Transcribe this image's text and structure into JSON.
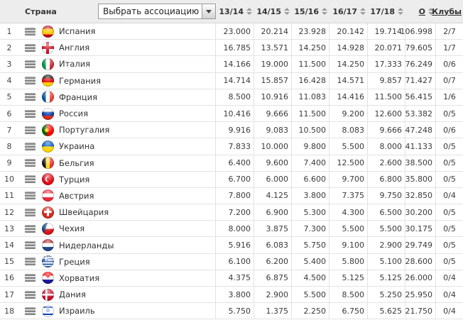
{
  "colors": {
    "header_bg": "#ededed",
    "row_border": "#e3e3e3",
    "text": "#333333",
    "sort_arrow": "#9b9b9b"
  },
  "header": {
    "country_label": "Страна",
    "dropdown_value": "Выбрать ассоциацию",
    "season_columns": [
      "13/14",
      "14/15",
      "15/16",
      "16/17",
      "17/18"
    ],
    "total_label": "О",
    "clubs_label": "Клубы"
  },
  "rows": [
    {
      "rank": "1",
      "flag": "es",
      "country": "Испания",
      "seasons": [
        "23.000",
        "20.214",
        "23.928",
        "20.142",
        "19.714"
      ],
      "total": "106.998",
      "clubs": "2/7"
    },
    {
      "rank": "2",
      "flag": "en",
      "country": "Англия",
      "seasons": [
        "16.785",
        "13.571",
        "14.250",
        "14.928",
        "20.071"
      ],
      "total": "79.605",
      "clubs": "1/7"
    },
    {
      "rank": "3",
      "flag": "it",
      "country": "Италия",
      "seasons": [
        "14.166",
        "19.000",
        "11.500",
        "14.250",
        "17.333"
      ],
      "total": "76.249",
      "clubs": "0/6"
    },
    {
      "rank": "4",
      "flag": "de",
      "country": "Германия",
      "seasons": [
        "14.714",
        "15.857",
        "16.428",
        "14.571",
        "9.857"
      ],
      "total": "71.427",
      "clubs": "0/7"
    },
    {
      "rank": "5",
      "flag": "fr",
      "country": "Франция",
      "seasons": [
        "8.500",
        "10.916",
        "11.083",
        "14.416",
        "11.500"
      ],
      "total": "56.415",
      "clubs": "1/6"
    },
    {
      "rank": "6",
      "flag": "ru",
      "country": "Россия",
      "seasons": [
        "10.416",
        "9.666",
        "11.500",
        "9.200",
        "12.600"
      ],
      "total": "53.382",
      "clubs": "0/5"
    },
    {
      "rank": "7",
      "flag": "pt",
      "country": "Португалия",
      "seasons": [
        "9.916",
        "9.083",
        "10.500",
        "8.083",
        "9.666"
      ],
      "total": "47.248",
      "clubs": "0/6"
    },
    {
      "rank": "8",
      "flag": "ua",
      "country": "Украина",
      "seasons": [
        "7.833",
        "10.000",
        "9.800",
        "5.500",
        "8.000"
      ],
      "total": "41.133",
      "clubs": "0/5"
    },
    {
      "rank": "9",
      "flag": "be",
      "country": "Бельгия",
      "seasons": [
        "6.400",
        "9.600",
        "7.400",
        "12.500",
        "2.600"
      ],
      "total": "38.500",
      "clubs": "0/5"
    },
    {
      "rank": "10",
      "flag": "tr",
      "country": "Турция",
      "seasons": [
        "6.700",
        "6.000",
        "6.600",
        "9.700",
        "6.800"
      ],
      "total": "35.800",
      "clubs": "0/5"
    },
    {
      "rank": "11",
      "flag": "at",
      "country": "Австрия",
      "seasons": [
        "7.800",
        "4.125",
        "3.800",
        "7.375",
        "9.750"
      ],
      "total": "32.850",
      "clubs": "0/4"
    },
    {
      "rank": "12",
      "flag": "ch",
      "country": "Швейцария",
      "seasons": [
        "7.200",
        "6.900",
        "5.300",
        "4.300",
        "6.500"
      ],
      "total": "30.200",
      "clubs": "0/5"
    },
    {
      "rank": "13",
      "flag": "cz",
      "country": "Чехия",
      "seasons": [
        "8.000",
        "3.875",
        "7.300",
        "5.500",
        "5.500"
      ],
      "total": "30.175",
      "clubs": "0/5"
    },
    {
      "rank": "14",
      "flag": "nl",
      "country": "Нидерланды",
      "seasons": [
        "5.916",
        "6.083",
        "5.750",
        "9.100",
        "2.900"
      ],
      "total": "29.749",
      "clubs": "0/5"
    },
    {
      "rank": "15",
      "flag": "gr",
      "country": "Греция",
      "seasons": [
        "6.100",
        "6.200",
        "5.400",
        "5.800",
        "5.100"
      ],
      "total": "28.600",
      "clubs": "0/5"
    },
    {
      "rank": "16",
      "flag": "hr",
      "country": "Хорватия",
      "seasons": [
        "4.375",
        "6.875",
        "4.500",
        "5.125",
        "5.125"
      ],
      "total": "26.000",
      "clubs": "0/4"
    },
    {
      "rank": "17",
      "flag": "dk",
      "country": "Дания",
      "seasons": [
        "3.800",
        "2.900",
        "5.500",
        "8.500",
        "5.250"
      ],
      "total": "25.950",
      "clubs": "0/4"
    },
    {
      "rank": "18",
      "flag": "il",
      "country": "Израиль",
      "seasons": [
        "5.750",
        "1.375",
        "2.250",
        "6.750",
        "5.625"
      ],
      "total": "21.750",
      "clubs": "0/4"
    }
  ]
}
